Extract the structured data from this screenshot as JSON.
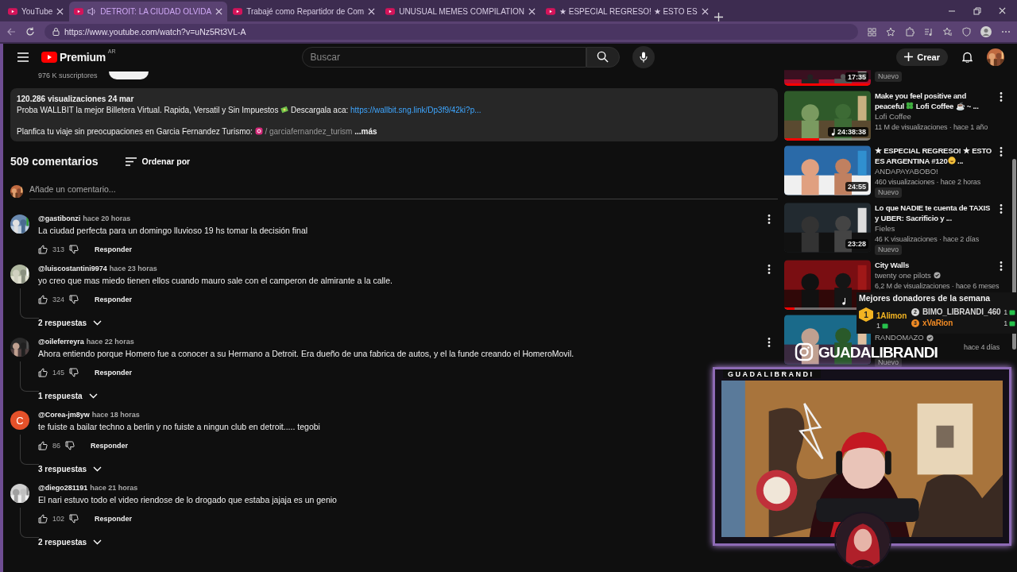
{
  "browser": {
    "tabs": [
      {
        "title": "YouTube",
        "selected": false,
        "audio": false
      },
      {
        "title": "DETROIT: LA CIUDAD OLVIDA",
        "selected": true,
        "audio": true
      },
      {
        "title": "Trabajé como Repartidor de Com",
        "selected": false,
        "audio": false
      },
      {
        "title": "UNUSUAL MEMES COMPILATION",
        "selected": false,
        "audio": false
      },
      {
        "title": "★ ESPECIAL REGRESO! ★ ESTO ES",
        "selected": false,
        "audio": false
      }
    ],
    "url": "https://www.youtube.com/watch?v=uNz5Rt3VL-A"
  },
  "header": {
    "logo_text": "Premium",
    "region": "AR",
    "search_placeholder": "Buscar",
    "create_label": "Crear"
  },
  "channel": {
    "subscribers": "976 K suscriptores"
  },
  "description": {
    "views": "120.286 visualizaciones",
    "date": "24 mar",
    "lines": [
      {
        "parts": [
          {
            "kind": "text",
            "text": "Proba WALLBIT la mejor Billetera Virtual. Rapida, Versatil y Sin Impuestos "
          },
          {
            "kind": "icon"
          },
          {
            "kind": "text",
            "text": " Descargala aca: "
          },
          {
            "kind": "link",
            "text": "https://wallbit.sng.link/Dp3f9/42ki?p..."
          }
        ]
      },
      {
        "parts": [
          {
            "kind": "text",
            "text": "Planfica tu viaje sin preocupaciones en Garcia Fernandez Turismo: "
          },
          {
            "kind": "icon"
          },
          {
            "kind": "faded",
            "text": " / garciafernandez_turism"
          },
          {
            "kind": "more",
            "text": " ...más"
          }
        ]
      }
    ]
  },
  "comments": {
    "count": "509 comentarios",
    "sort_label": "Ordenar por",
    "add_placeholder": "Añade un comentario...",
    "items": [
      {
        "author": "@gastibonzi",
        "time": "hace 20 horas",
        "text": "La ciudad perfecta para un domingo lluvioso 19 hs tomar la decisión final",
        "likes": "313",
        "reply_label": "Responder"
      },
      {
        "author": "@luiscostantini9974",
        "time": "hace 23 horas",
        "text": "yo creo que mas miedo tienen ellos cuando mauro sale con el camperon de almirante a la calle.",
        "likes": "324",
        "reply_label": "Responder",
        "replies": "2 respuestas"
      },
      {
        "author": "@oileferreyra",
        "time": "hace 22 horas",
        "text": "Ahora entiendo porque Homero fue a conocer a su Hermano a Detroit. Era dueño de una fabrica de autos, y el la funde creando el HomeroMovil.",
        "likes": "145",
        "reply_label": "Responder",
        "replies": "1 respuesta"
      },
      {
        "author": "@Corea-jm8yw",
        "time": "hace 18 horas",
        "text": "te fuiste a bailar techno a berlin y no fuiste a ningun club en detroit..... tegobi",
        "likes": "86",
        "reply_label": "Responder",
        "replies": "3 respuestas",
        "avatar": {
          "kind": "letter",
          "letter": "C",
          "color": "#e4512a"
        }
      },
      {
        "author": "@diego281191",
        "time": "hace 21 horas",
        "text": "El nari estuvo todo el video riendose de lo drogado que estaba jajaja es un genio",
        "likes": "102",
        "reply_label": "Responder",
        "replies": "2 respuestas"
      }
    ]
  },
  "sidebar": {
    "items": [
      {
        "kind": "cut",
        "duration": "17:35",
        "badge": "Nuevo",
        "level": 1
      },
      {
        "kind": "video",
        "title": [
          {
            "kind": "text",
            "text": "Make you feel positive and peaceful "
          },
          {
            "kind": "icon"
          },
          {
            "kind": "text",
            "text": " Lofi Coffee ☕ ~ ..."
          }
        ],
        "channel": "Lofi Coffee",
        "verified": false,
        "meta": "11 M de visualizaciones · hace 1 año",
        "duration": "24:38:38",
        "music": true,
        "level": 0.4
      },
      {
        "kind": "video",
        "title": [
          {
            "kind": "text",
            "text": "★ ESPECIAL REGRESO! ★ ESTO ES ARGENTINA #120"
          },
          {
            "kind": "icon"
          },
          {
            "kind": "text",
            "text": " ..."
          }
        ],
        "channel": "ANDAPAYABOBO!",
        "verified": false,
        "meta": "460 visualizaciones · hace 2 horas",
        "duration": "24:55",
        "music": false,
        "badge": "Nuevo"
      },
      {
        "kind": "video",
        "title": [
          {
            "kind": "text",
            "text": "Lo que NADIE te cuenta de TAXIS y UBER: Sacrificio y ..."
          }
        ],
        "channel": "Fieles",
        "verified": false,
        "meta": "46 K visualizaciones · hace 2 días",
        "duration": "23:28",
        "music": false,
        "badge": "Nuevo"
      },
      {
        "kind": "video",
        "title": [
          {
            "kind": "text",
            "text": "City Walls"
          }
        ],
        "channel": "twenty one pilots",
        "verified": true,
        "meta": "6,2 M de visualizaciones · hace 6 meses",
        "music": true,
        "level": 0.12
      },
      {
        "kind": "video",
        "channel": "RANDOMAZO",
        "verified": true,
        "meta": "hace 4 días",
        "music": false,
        "badge": "Nuevo"
      }
    ]
  },
  "overlay": {
    "donors": {
      "title": "Mejores donadores de la semana",
      "entries": [
        {
          "rank": "1",
          "name": "1Alimon",
          "count": "1",
          "color": "#f2b322"
        },
        {
          "rank": "2",
          "name": "BIMO_LIBRANDI_460",
          "count": "1",
          "color": "#d6d6d6"
        },
        {
          "rank": "3",
          "name": "xVaRion",
          "count": "1",
          "color": "#f08a24"
        }
      ]
    },
    "instagram": "GUADALIBRANDI",
    "cam_label": "GUADALIBRANDI"
  }
}
